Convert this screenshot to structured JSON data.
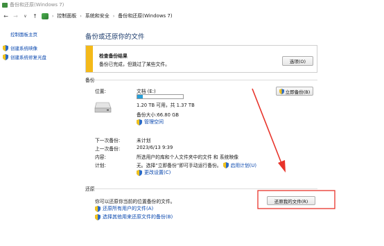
{
  "window": {
    "title": "备份和还原(Windows 7)"
  },
  "nav": {
    "breadcrumb": [
      "控制面板",
      "系统和安全",
      "备份和还原(Windows 7)"
    ]
  },
  "sidebar": {
    "home_label": "控制面板主页",
    "items": [
      {
        "label": "创建系统映像",
        "icon": "shield-icon"
      },
      {
        "label": "创建系统修复光盘",
        "icon": "shield-icon"
      }
    ]
  },
  "main": {
    "title": "备份或还原你的文件",
    "banner": {
      "title": "检查备份结果",
      "message": "备份已完成，但跳过了某些文件。",
      "options_button": "选项(O)",
      "accent": "#f4b919"
    },
    "backup": {
      "section_label": "备份",
      "location_label": "位置:",
      "location_value": "文档 (E:)",
      "usage_fraction": 0.124,
      "space_text": "1.20 TB 可用，共 1.37 TB",
      "backup_size": "备份大小:66.80 GB",
      "manage_space": "管理空间",
      "backup_now_button": "立即备份(B)",
      "next_backup_label": "下一次备份:",
      "next_backup_value": "未计划",
      "last_backup_label": "上一次备份:",
      "last_backup_value": "2023/6/13 9:39",
      "contents_label": "内容:",
      "contents_value": "所选用户的库和个人文件夹中的文件 和 系统映像",
      "schedule_label": "计划:",
      "schedule_value": "无。选择“立即备份”即可手动运行备份。",
      "enable_schedule": "启用计划(U)",
      "change_settings": "更改设置(C)"
    },
    "restore": {
      "section_label": "还原",
      "description": "你可以还原你当前的位置备份的文件。",
      "restore_my_files_button": "还原我的文件(R)",
      "restore_all_users": "还原所有用户的文件(A)",
      "select_other_backup": "选择其他用来还原文件的备份(B)"
    }
  },
  "annotations": {
    "color": "#e8332a"
  }
}
